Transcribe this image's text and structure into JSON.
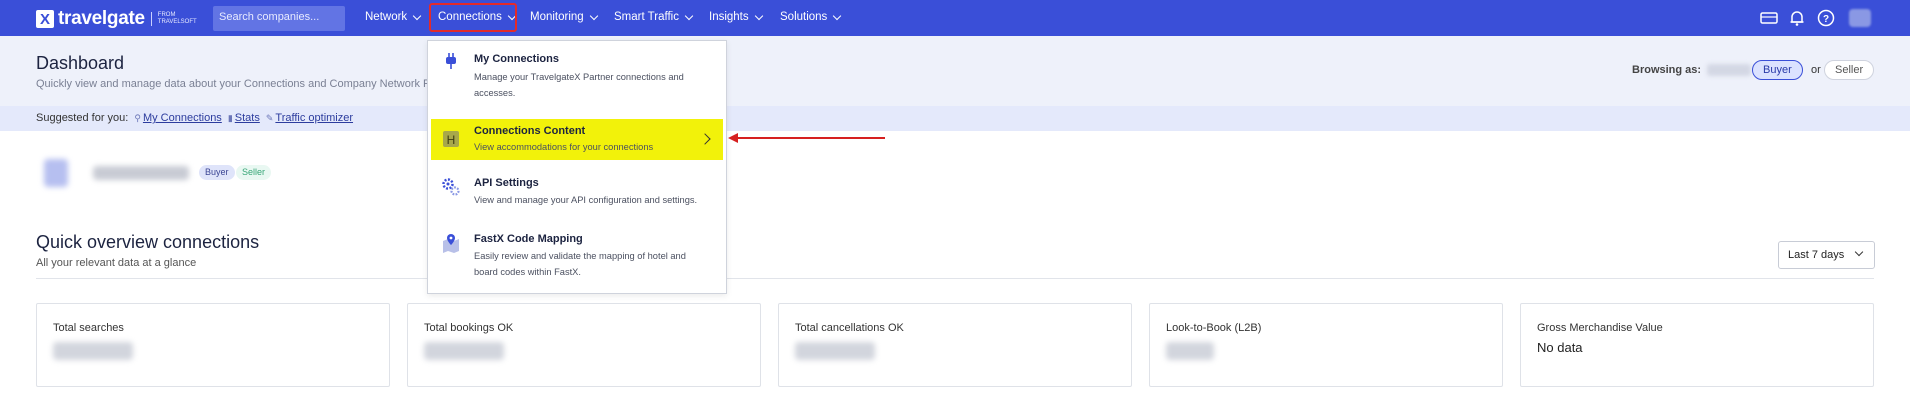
{
  "topbar": {
    "logo_text": "travelgate",
    "logo_from": "FROM",
    "logo_brand": "TRAVELSOFT",
    "search_placeholder": "Search companies...",
    "nav": [
      {
        "label": "Network"
      },
      {
        "label": "Connections"
      },
      {
        "label": "Monitoring"
      },
      {
        "label": "Smart Traffic"
      },
      {
        "label": "Insights"
      },
      {
        "label": "Solutions"
      }
    ],
    "icons": [
      "ticket-icon",
      "bell-icon",
      "help-icon",
      "user-avatar"
    ],
    "accent": "#3a4fd8"
  },
  "header": {
    "title": "Dashboard",
    "subtitle": "Quickly view and manage data about your Connections and Company Network Pro",
    "browsing_label": "Browsing as:",
    "buyer": "Buyer",
    "or": "or",
    "seller": "Seller"
  },
  "suggested": {
    "label": "Suggested for you:",
    "links": [
      "My Connections",
      "Stats",
      "Traffic optimizer"
    ]
  },
  "company": {
    "tags": [
      "Buyer",
      "Seller"
    ]
  },
  "overview": {
    "title": "Quick overview connections",
    "subtitle": "All your relevant data at a glance",
    "period": "Last 7 days",
    "cards": [
      {
        "label": "Total searches"
      },
      {
        "label": "Total bookings OK"
      },
      {
        "label": "Total cancellations OK"
      },
      {
        "label": "Look-to-Book (L2B)"
      },
      {
        "label": "Gross Merchandise Value",
        "value": "No data"
      }
    ]
  },
  "dropdown": {
    "items": [
      {
        "title": "My Connections",
        "desc": "Manage your TravelgateX Partner connections and accesses.",
        "icon": "plug-icon"
      },
      {
        "title": "Connections Content",
        "desc": "View accommodations for your connections",
        "icon": "hotel-icon",
        "highlight": "#f2f20a"
      },
      {
        "title": "API Settings",
        "desc": "View and manage your API configuration and settings.",
        "icon": "gears-icon"
      },
      {
        "title": "FastX Code Mapping",
        "desc": "Easily review and validate the mapping of hotel and board codes within FastX.",
        "icon": "map-pin-icon"
      }
    ]
  },
  "annotation_color": "#d62020"
}
